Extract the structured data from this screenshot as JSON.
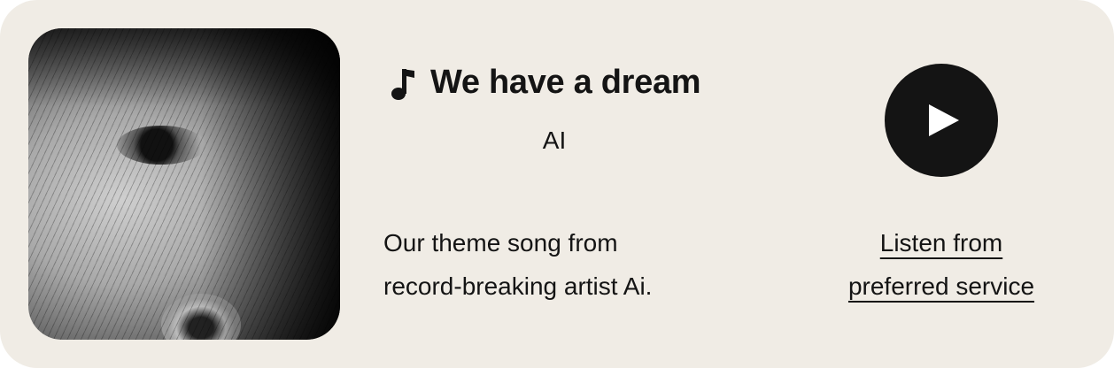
{
  "song": {
    "title": "We have a dream",
    "artist": "AI",
    "description_line1": "Our theme song from",
    "description_line2": "record-breaking artist Ai."
  },
  "actions": {
    "play_icon": "play-icon",
    "link_line1": "Listen from",
    "link_line2": "preferred service"
  },
  "colors": {
    "background": "#f0ece5",
    "text": "#141414",
    "button": "#141414"
  }
}
